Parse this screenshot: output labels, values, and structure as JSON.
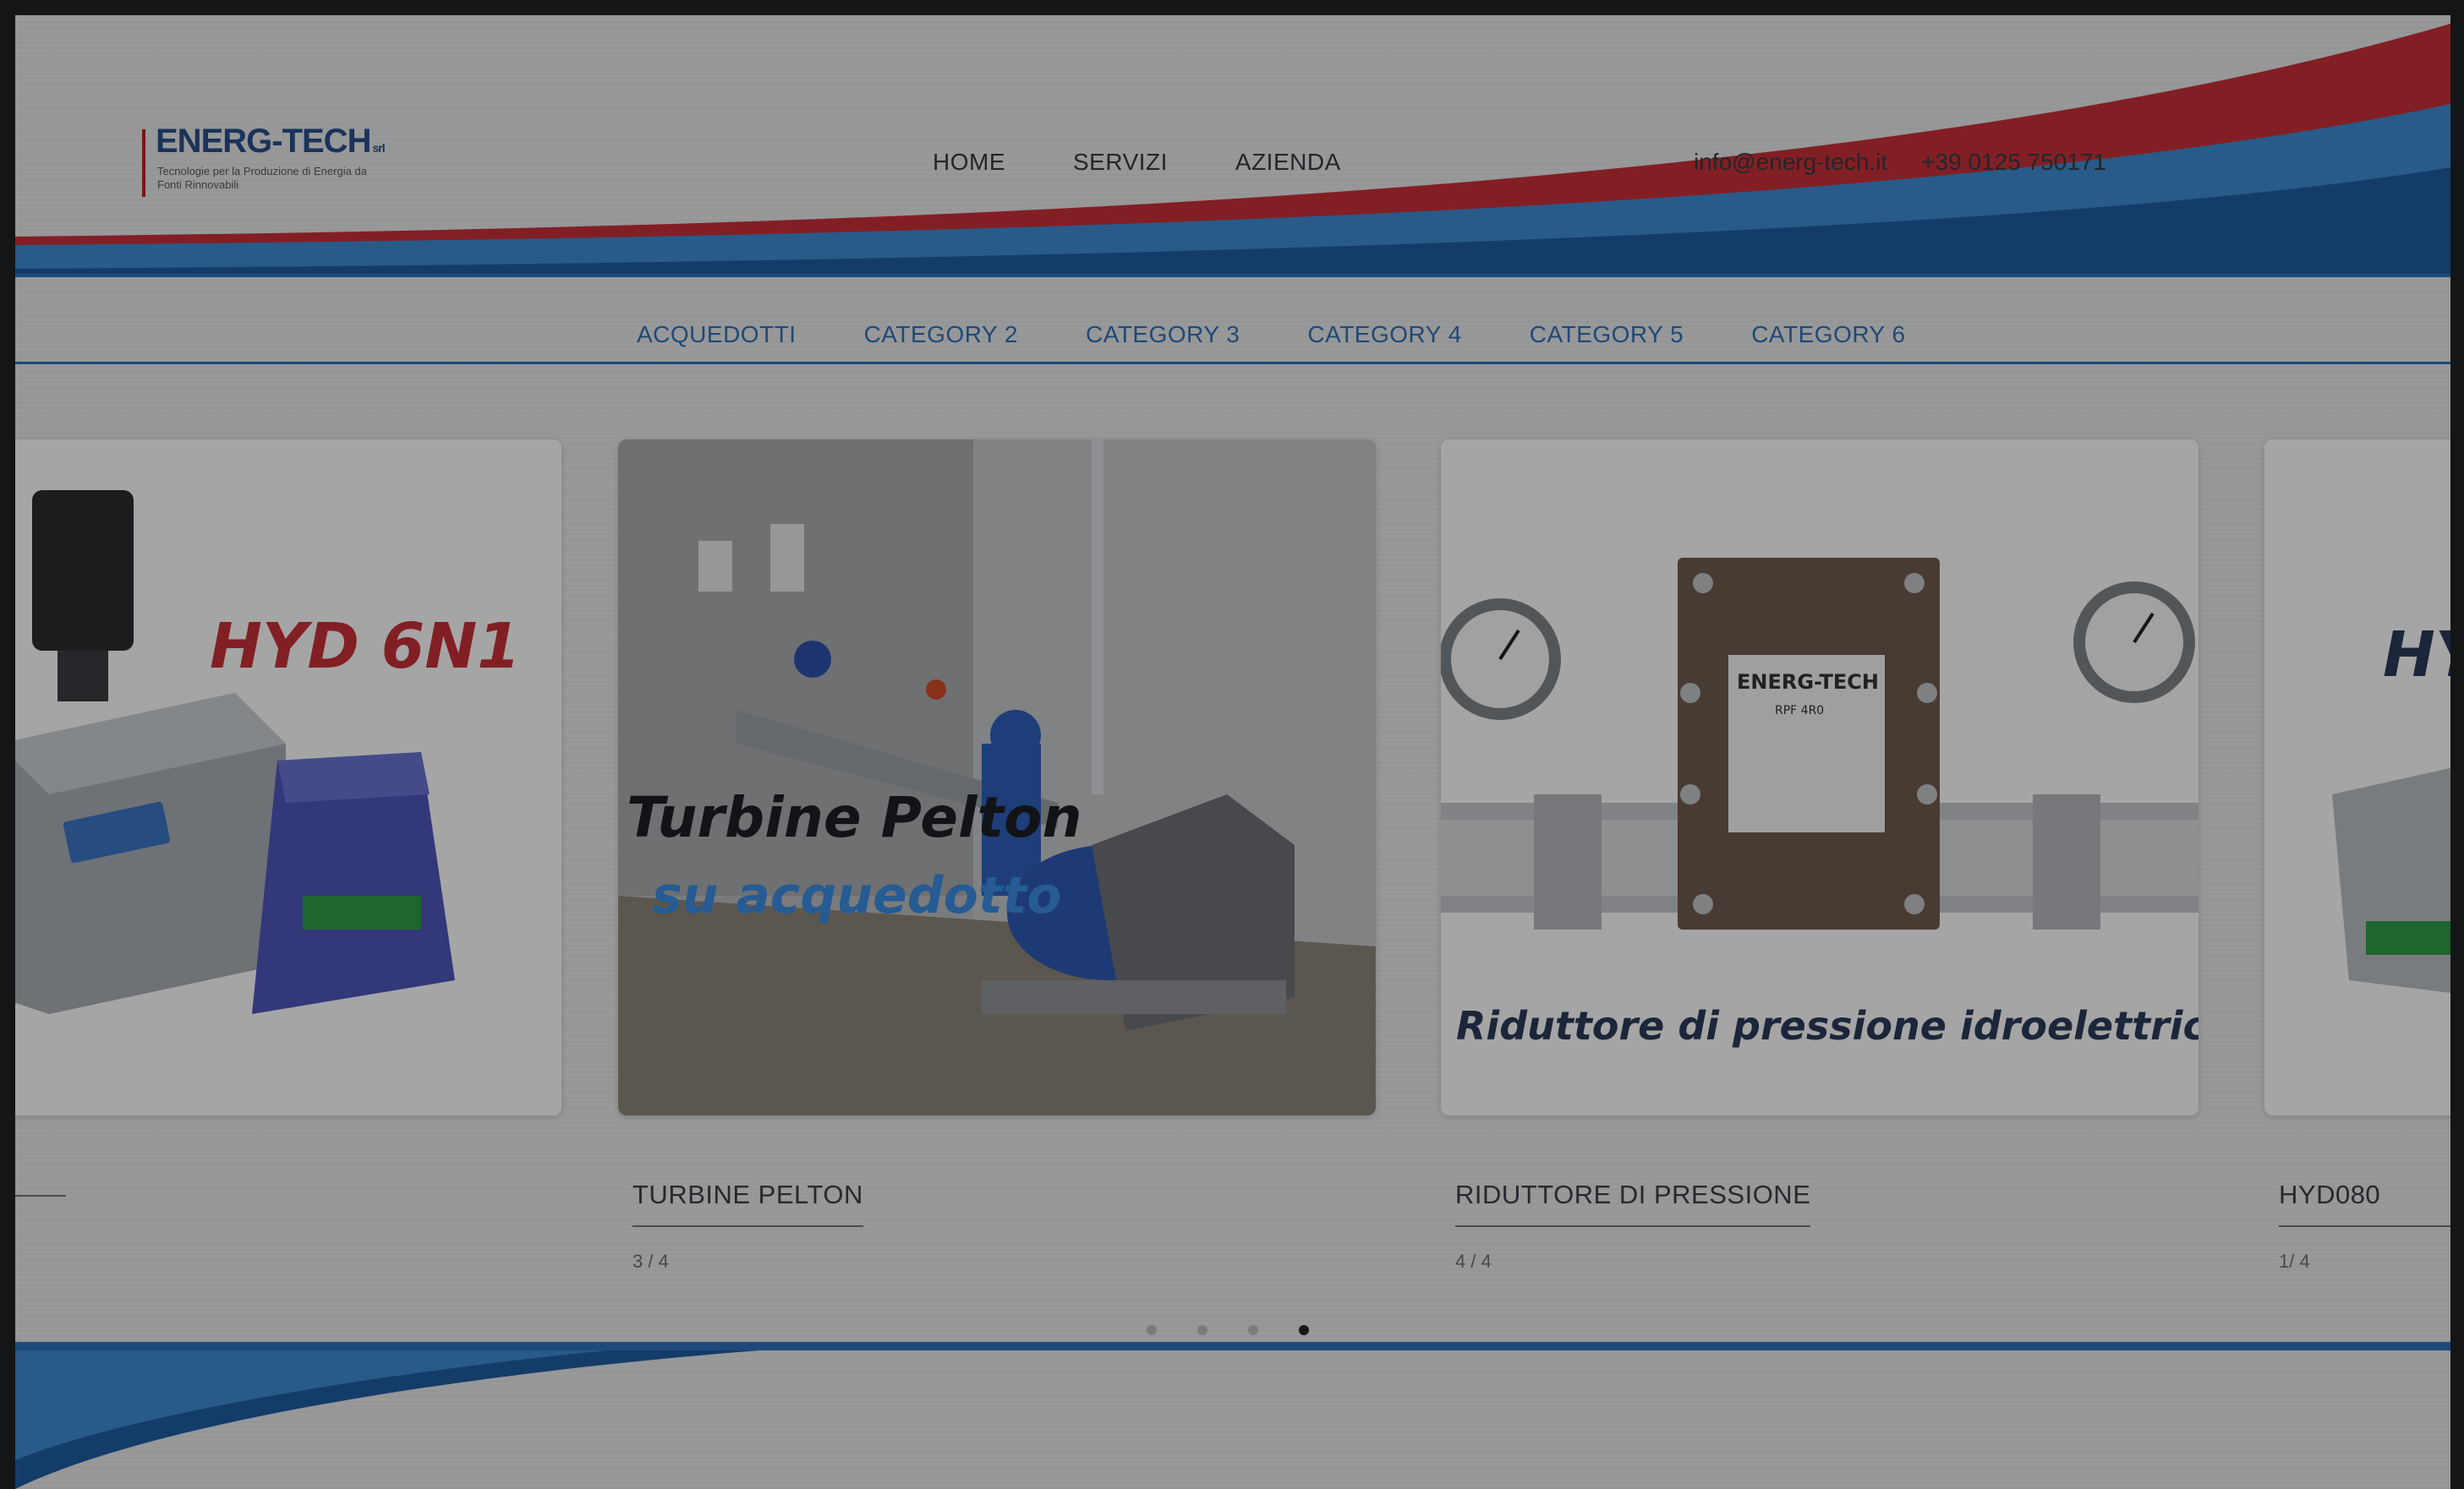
{
  "brand": {
    "name": "ENERG-TECH",
    "suffix": "srl",
    "tagline": "Tecnologie per la Produzione di Energia da Fonti Rinnovabili"
  },
  "nav": {
    "items": [
      "HOME",
      "SERVIZI",
      "AZIENDA"
    ]
  },
  "contact": {
    "email": "info@energ-tech.it",
    "phone": "+39 0125 750171"
  },
  "categories": [
    "ACQUEDOTTI",
    "CATEGORY 2",
    "CATEGORY 3",
    "CATEGORY 4",
    "CATEGORY 5",
    "CATEGORY 6"
  ],
  "slides": [
    {
      "image_text": "HYD 6N1",
      "title": "",
      "count": ""
    },
    {
      "image_text_1": "Turbine Pelton",
      "image_text_2": "su acquedotto",
      "title": "TURBINE PELTON",
      "count": "3 / 4"
    },
    {
      "image_text": "Riduttore di pressione idroelettrico",
      "plate_label": "ENERG-TECH",
      "plate_model": "RPF 4R0",
      "title": "RIDUTTORE DI PRESSIONE",
      "count": "4 / 4"
    },
    {
      "image_text": "HY",
      "title": "HYD080",
      "count": "1/ 4"
    }
  ],
  "pagination": {
    "total": 4,
    "active": 4
  },
  "colors": {
    "accent_blue": "#2d71b8",
    "accent_red": "#c62f38",
    "text_dark": "#353a40"
  }
}
